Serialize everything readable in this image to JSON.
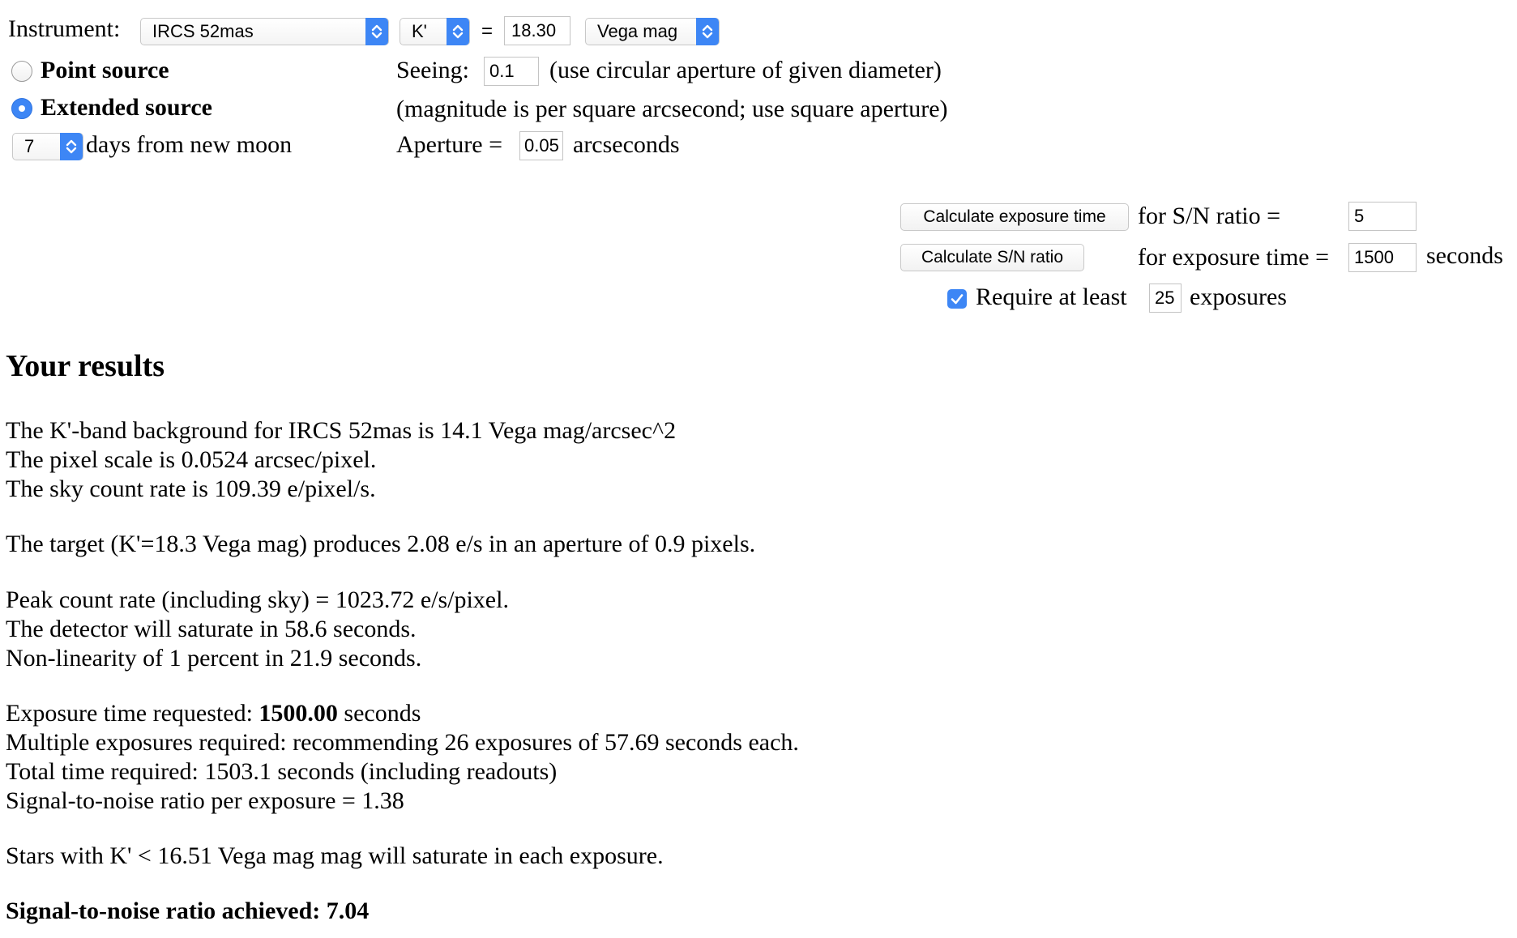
{
  "form": {
    "instrument_label": "Instrument:",
    "instrument_value": "IRCS 52mas",
    "band_value": "K'",
    "equals": "=",
    "magnitude_value": "18.30",
    "mag_system_value": "Vega mag",
    "point_source_label": "Point source",
    "extended_source_label": "Extended source",
    "selected_source": "extended",
    "moon_days_value": "7",
    "moon_days_label": "days from new moon",
    "seeing_label": "Seeing:",
    "seeing_value": "0.1",
    "seeing_note": "(use circular aperture of given diameter)",
    "extended_note": "(magnitude is per square arcsecond; use square aperture)",
    "aperture_label": "Aperture =",
    "aperture_value": "0.05",
    "aperture_unit": "arcseconds"
  },
  "calc": {
    "calc_exposure_button": "Calculate exposure time",
    "sn_ratio_label": "for S/N ratio =",
    "sn_ratio_value": "5",
    "calc_sn_button": "Calculate S/N ratio",
    "exposure_time_label": "for exposure time =",
    "exposure_time_value": "1500",
    "seconds_label": "seconds",
    "require_checked": true,
    "require_label": "Require at least",
    "require_value": "25",
    "exposures_label": "exposures"
  },
  "results": {
    "heading": "Your results",
    "line1": "The K'-band background for IRCS 52mas is 14.1 Vega mag/arcsec^2",
    "line2": "The pixel scale is 0.0524 arcsec/pixel.",
    "line3": "The sky count rate is 109.39 e/pixel/s.",
    "line4": "The target (K'=18.3 Vega mag) produces 2.08 e/s in an aperture of 0.9 pixels.",
    "line5": "Peak count rate (including sky) = 1023.72 e/s/pixel.",
    "line6": "The detector will saturate in 58.6 seconds.",
    "line7": "Non-linearity of 1 percent in 21.9 seconds.",
    "exp_requested_prefix": "Exposure time requested: ",
    "exp_requested_value": "1500.00",
    "exp_requested_suffix": " seconds",
    "line9": "Multiple exposures required: recommending 26 exposures of 57.69 seconds each.",
    "line10": "Total time required: 1503.1 seconds (including readouts)",
    "line11": "Signal-to-noise ratio per exposure = 1.38",
    "line12": "Stars with K' < 16.51 Vega mag mag will saturate in each exposure.",
    "final": "Signal-to-noise ratio achieved: 7.04"
  }
}
